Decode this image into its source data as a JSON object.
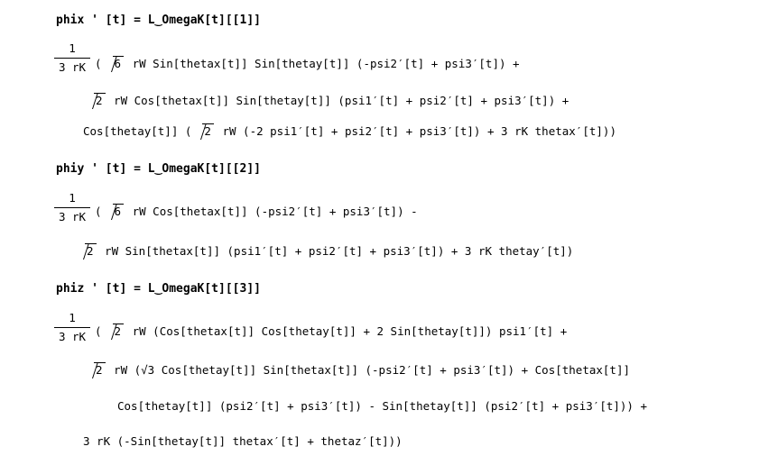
{
  "blocks": [
    {
      "input": "phix ' [t] = L‿OmegaK[t][[1]]",
      "frac_num": "1",
      "frac_den": "3 rK",
      "lines": [
        [
          "(",
          "√6",
          " rW Sin[thetax[t]] Sin[thetay[t]] (-psi2′[t] + psi3′[t]) +"
        ],
        [
          "",
          "√2",
          " rW Cos[thetax[t]] Sin[thetay[t]] (psi1′[t] + psi2′[t] + psi3′[t]) +"
        ],
        [
          "Cos[thetay[t]] (",
          "√2",
          " rW (-2 psi1′[t] + psi2′[t] + psi3′[t]) + 3 rK thetax′[t]))"
        ]
      ]
    },
    {
      "input": "phiy ' [t] = L‿OmegaK[t][[2]]",
      "frac_num": "1",
      "frac_den": "3 rK",
      "lines": [
        [
          "(",
          "√6",
          " rW Cos[thetax[t]] (-psi2′[t] + psi3′[t]) -"
        ],
        [
          "",
          "√2",
          " rW Sin[thetax[t]] (psi1′[t] + psi2′[t] + psi3′[t]) + 3 rK thetay′[t])"
        ]
      ]
    },
    {
      "input": "phiz ' [t] = L‿OmegaK[t][[3]]",
      "frac_num": "1",
      "frac_den": "3 rK",
      "lines": [
        [
          "(",
          "√2",
          " rW (Cos[thetax[t]] Cos[thetay[t]] + 2 Sin[thetay[t]]) psi1′[t] +"
        ],
        [
          "",
          "√2",
          " rW (√3 Cos[thetay[t]] Sin[thetax[t]] (-psi2′[t] + psi3′[t]) + Cos[thetax[t]]"
        ],
        [
          "",
          "",
          "Cos[thetay[t]] (psi2′[t] + psi3′[t]) - Sin[thetay[t]] (psi2′[t] + psi3′[t])) +"
        ],
        [
          "",
          "",
          "3 rK (-Sin[thetay[t]] thetax′[t] + thetaz′[t]))"
        ]
      ]
    }
  ]
}
